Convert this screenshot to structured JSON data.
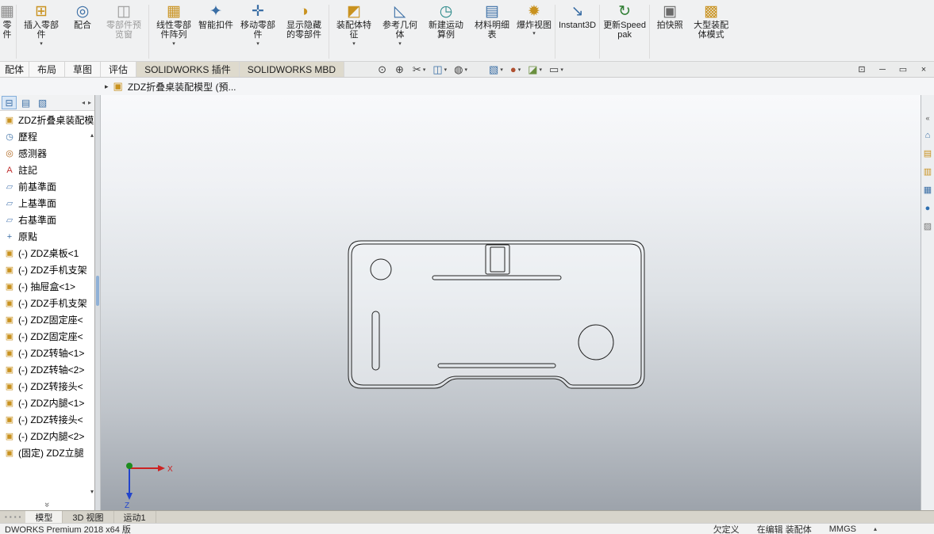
{
  "ribbon": {
    "buttons": [
      {
        "label": "零件",
        "glyph": "▦",
        "color": "#8a8a8a",
        "arrow": ""
      },
      {
        "label": "插入零部件",
        "glyph": "⊞",
        "color": "#c9921f",
        "arrow": "▾"
      },
      {
        "label": "配合",
        "glyph": "◎",
        "color": "#3a6ea5",
        "arrow": ""
      },
      {
        "label": "零部件预览窗",
        "glyph": "◫",
        "color": "#9a9a9a",
        "arrow": "",
        "text_color": "#9a9a9a"
      },
      {
        "label": "线性零部件阵列",
        "glyph": "▦",
        "color": "#c9921f",
        "arrow": "▾"
      },
      {
        "label": "智能扣件",
        "glyph": "✦",
        "color": "#3a6ea5",
        "arrow": ""
      },
      {
        "label": "移动零部件",
        "glyph": "✛",
        "color": "#3a6ea5",
        "arrow": "▾"
      },
      {
        "label": "显示隐藏的零部件",
        "glyph": "◑",
        "color": "#c9921f",
        "arrow": ""
      },
      {
        "label": "装配体特征",
        "glyph": "◩",
        "color": "#c9921f",
        "arrow": "▾"
      },
      {
        "label": "参考几何体",
        "glyph": "◺",
        "color": "#3a6ea5",
        "arrow": "▾"
      },
      {
        "label": "新建运动算例",
        "glyph": "◷",
        "color": "#2e8b8b",
        "arrow": ""
      },
      {
        "label": "材料明细表",
        "glyph": "▤",
        "color": "#3a6ea5",
        "arrow": ""
      },
      {
        "label": "爆炸视图",
        "glyph": "✹",
        "color": "#c9921f",
        "arrow": "▾"
      },
      {
        "label": "Instant3D",
        "glyph": "↘",
        "color": "#3a6ea5",
        "arrow": ""
      },
      {
        "label": "更新Speedpak",
        "glyph": "↻",
        "color": "#2e7d32",
        "arrow": ""
      },
      {
        "label": "拍快照",
        "glyph": "▣",
        "color": "#6a6a6a",
        "arrow": ""
      },
      {
        "label": "大型装配体模式",
        "glyph": "▩",
        "color": "#c9921f",
        "arrow": ""
      }
    ]
  },
  "tabs": {
    "items": [
      {
        "label": "配体"
      },
      {
        "label": "布局"
      },
      {
        "label": "草图"
      },
      {
        "label": "评估"
      },
      {
        "label": "SOLIDWORKS 插件"
      },
      {
        "label": "SOLIDWORKS MBD"
      }
    ]
  },
  "hud": {
    "icons": [
      {
        "glyph": "⊙",
        "color": "#3f3f3f",
        "arrow": ""
      },
      {
        "glyph": "⊕",
        "color": "#3f3f3f",
        "arrow": ""
      },
      {
        "glyph": "✂",
        "color": "#3f3f3f",
        "arrow": "▾"
      },
      {
        "glyph": "◫",
        "color": "#3a6ea5",
        "arrow": "▾"
      },
      {
        "glyph": "◍",
        "color": "#3f3f3f",
        "arrow": "▾"
      },
      {
        "glyph": "▧",
        "color": "#3a6ea5",
        "arrow": "▾"
      },
      {
        "glyph": "●",
        "color": "#b05030",
        "arrow": "▾"
      },
      {
        "glyph": "◪",
        "color": "#6a8f3f",
        "arrow": "▾"
      },
      {
        "glyph": "▭",
        "color": "#3f3f3f",
        "arrow": "▾"
      }
    ]
  },
  "window_controls": {
    "items": [
      {
        "glyph": "⊡"
      },
      {
        "glyph": "─"
      },
      {
        "glyph": "▭"
      },
      {
        "glyph": "×"
      }
    ]
  },
  "breadcrumb": {
    "expander": "▸",
    "icon_glyph": "▣",
    "title": "ZDZ折叠桌装配模型 (預..."
  },
  "panel_tabs": {
    "tabs": [
      {
        "glyph": "⊟"
      },
      {
        "glyph": "▤"
      },
      {
        "glyph": "▧"
      }
    ],
    "scroll_left": "◂",
    "scroll_right": "▸"
  },
  "tree": {
    "header": {
      "icon_glyph": "▣",
      "icon_color": "#c9921f",
      "label": "ZDZ折叠桌装配模型"
    },
    "scroll_up": "▴",
    "scroll_down": "▾",
    "footer_chevron": "»",
    "items": [
      {
        "glyph": "◷",
        "color": "#3a6ea5",
        "label": "歷程"
      },
      {
        "glyph": "◎",
        "color": "#b06820",
        "label": "感测器"
      },
      {
        "glyph": "A",
        "color": "#c03030",
        "label": "註記"
      },
      {
        "glyph": "▱",
        "color": "#5b84b8",
        "label": "前基準面"
      },
      {
        "glyph": "▱",
        "color": "#5b84b8",
        "label": "上基準面"
      },
      {
        "glyph": "▱",
        "color": "#5b84b8",
        "label": "右基準面"
      },
      {
        "glyph": "+",
        "color": "#3a6ea5",
        "label": "原點"
      },
      {
        "glyph": "▣",
        "color": "#c9921f",
        "label": "(-) ZDZ桌板<1"
      },
      {
        "glyph": "▣",
        "color": "#c9921f",
        "label": "(-) ZDZ手机支架"
      },
      {
        "glyph": "▣",
        "color": "#c9921f",
        "label": "(-) 抽屉盒<1>"
      },
      {
        "glyph": "▣",
        "color": "#c9921f",
        "label": "(-) ZDZ手机支架"
      },
      {
        "glyph": "▣",
        "color": "#c9921f",
        "label": "(-) ZDZ固定座<"
      },
      {
        "glyph": "▣",
        "color": "#c9921f",
        "label": "(-) ZDZ固定座<"
      },
      {
        "glyph": "▣",
        "color": "#c9921f",
        "label": "(-) ZDZ转轴<1>"
      },
      {
        "glyph": "▣",
        "color": "#c9921f",
        "label": "(-) ZDZ转轴<2>"
      },
      {
        "glyph": "▣",
        "color": "#c9921f",
        "label": "(-) ZDZ转接头<"
      },
      {
        "glyph": "▣",
        "color": "#c9921f",
        "label": "(-) ZDZ内腿<1>"
      },
      {
        "glyph": "▣",
        "color": "#c9921f",
        "label": "(-) ZDZ转接头<"
      },
      {
        "glyph": "▣",
        "color": "#c9921f",
        "label": "(-) ZDZ内腿<2>"
      },
      {
        "glyph": "▣",
        "color": "#c9921f",
        "label": "(固定) ZDZ立腿"
      }
    ]
  },
  "taskpane": {
    "collapse_glyph": "«",
    "icons": [
      {
        "glyph": "⌂",
        "color": "#3a6ea5"
      },
      {
        "glyph": "▤",
        "color": "#c9921f"
      },
      {
        "glyph": "▥",
        "color": "#c9921f"
      },
      {
        "glyph": "▦",
        "color": "#3a6ea5"
      },
      {
        "glyph": "●",
        "color": "#2e6fb0"
      },
      {
        "glyph": "▨",
        "color": "#777777"
      }
    ]
  },
  "bottom_tabs": {
    "mini_icons": [
      "▪",
      "▪",
      "▪",
      "▪"
    ],
    "tabs": [
      {
        "label": "模型"
      },
      {
        "label": "3D 视图"
      },
      {
        "label": "运动1"
      }
    ]
  },
  "statusbar": {
    "app_info": "DWORKS Premium 2018 x64 版",
    "define_status": "欠定义",
    "edit_status": "在编辑 装配体",
    "units": "MMGS",
    "units_caret": "▴"
  },
  "viewport": {
    "triad": {
      "x": "X",
      "z": "Z"
    }
  }
}
